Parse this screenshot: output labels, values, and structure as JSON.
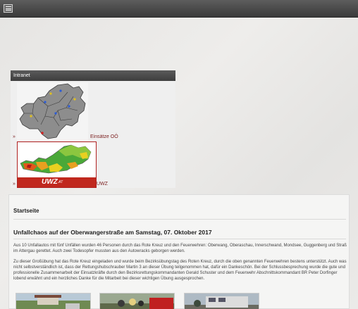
{
  "header": {
    "menu_icon": "hamburger-menu-icon"
  },
  "sidebar": {
    "title": "Intranet",
    "links": [
      {
        "bullet": "»",
        "label": "Einsätze OÖ",
        "image": "upper-austria-map"
      },
      {
        "bullet": "»",
        "label": "UWZ",
        "image": "uwz-weather-map"
      }
    ],
    "uwz_logo": {
      "text": "UWZ",
      "suffix": ".AT"
    }
  },
  "main": {
    "section_title": "Startseite",
    "article": {
      "title": "Unfallchaos auf der Oberwangerstraße am Samstag, 07. Oktober 2017",
      "paragraphs": [
        "Aus 10 Unfallautos  mit fünf Unfällen wurden 46 Personen durch das Rote Kreuz und den Feuerwehren: Oberwang, Oberaschau, Innerschwand, Mondsee, Guggenberg und Straß im Attergau gerettet. Auch zwei Todesopfer mussten aus den Autowracks geborgen werden.",
        "Zu dieser Großübung hat das Rote Kreuz eingeladen und wurde beim Bezirksübungstag des Roten Kreuz, durch die oben genannten Feuerwehren bestens unterstützt. Auch was nicht selbstverständlich ist, dass der Rettungshubschrauber Martin 3 an dieser Übung teilgenommen hat, dafür ein Dankeschön. Bei der Schlussbesprechung wurde die gute und professionelle Zusammenarbeit der Einsatzkräfte durch den Bezirksrettungskommandanten Gerald Schuster und dem Feuerwehr Abschnittskommandant BR Peter Dorfinger lobend erwähnt und ein herzliches Danke für die Mitarbeit bei dieser wichtigen Übung ausgesprochen."
      ]
    }
  },
  "colors": {
    "link": "#7a1c1c",
    "uwz_red": "#c0281e",
    "topbar": "#4a4a4a"
  }
}
